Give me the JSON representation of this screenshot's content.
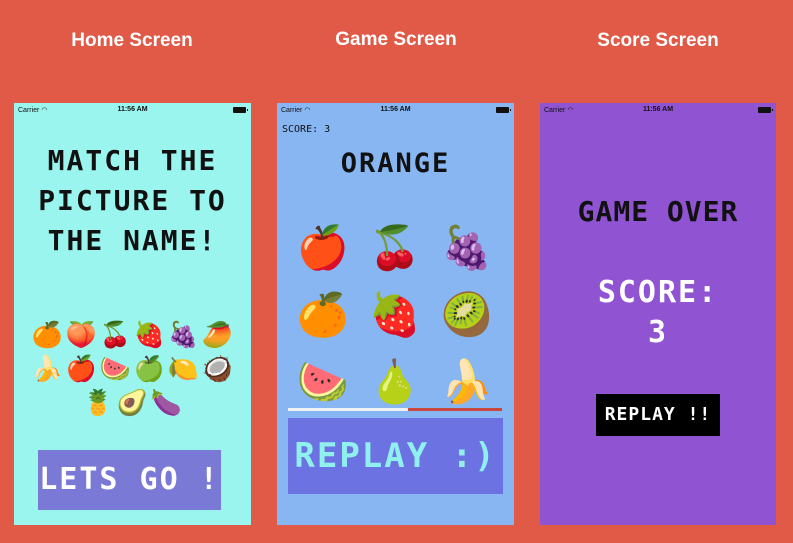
{
  "columns": {
    "home": "Home Screen",
    "game": "Game Screen",
    "score": "Score Screen"
  },
  "status_bar": {
    "carrier": "Carrier",
    "time": "11:56 AM",
    "wifi_icon": "wifi-icon",
    "battery_icon": "battery-icon"
  },
  "colors": {
    "background": "#e05a47",
    "home_bg": "#9af5ee",
    "game_bg": "#87b6f3",
    "score_bg": "#9053d2"
  },
  "home": {
    "title": "MATCH THE PICTURE TO THE NAME!",
    "fruits": [
      "🍊",
      "🍑",
      "🍒",
      "🍓",
      "🍇",
      "🥭",
      "🍌",
      "🍎",
      "🍉",
      "🍏",
      "🍋",
      "🥥",
      "🍍",
      "🥑",
      "🍆"
    ],
    "button_label": "LETS GO !"
  },
  "game": {
    "score_text": "SCORE: 3",
    "target_word": "ORANGE",
    "grid": [
      "🍎",
      "🍒",
      "🍇",
      "🍊",
      "🍓",
      "🥝",
      "🍉",
      "🍐",
      "🍌"
    ],
    "timer_progress": 0.56,
    "button_label": "REPLAY :)"
  },
  "score": {
    "title": "GAME OVER",
    "score_label": "SCORE:",
    "score_value": "3",
    "button_label": "REPLAY !!"
  }
}
